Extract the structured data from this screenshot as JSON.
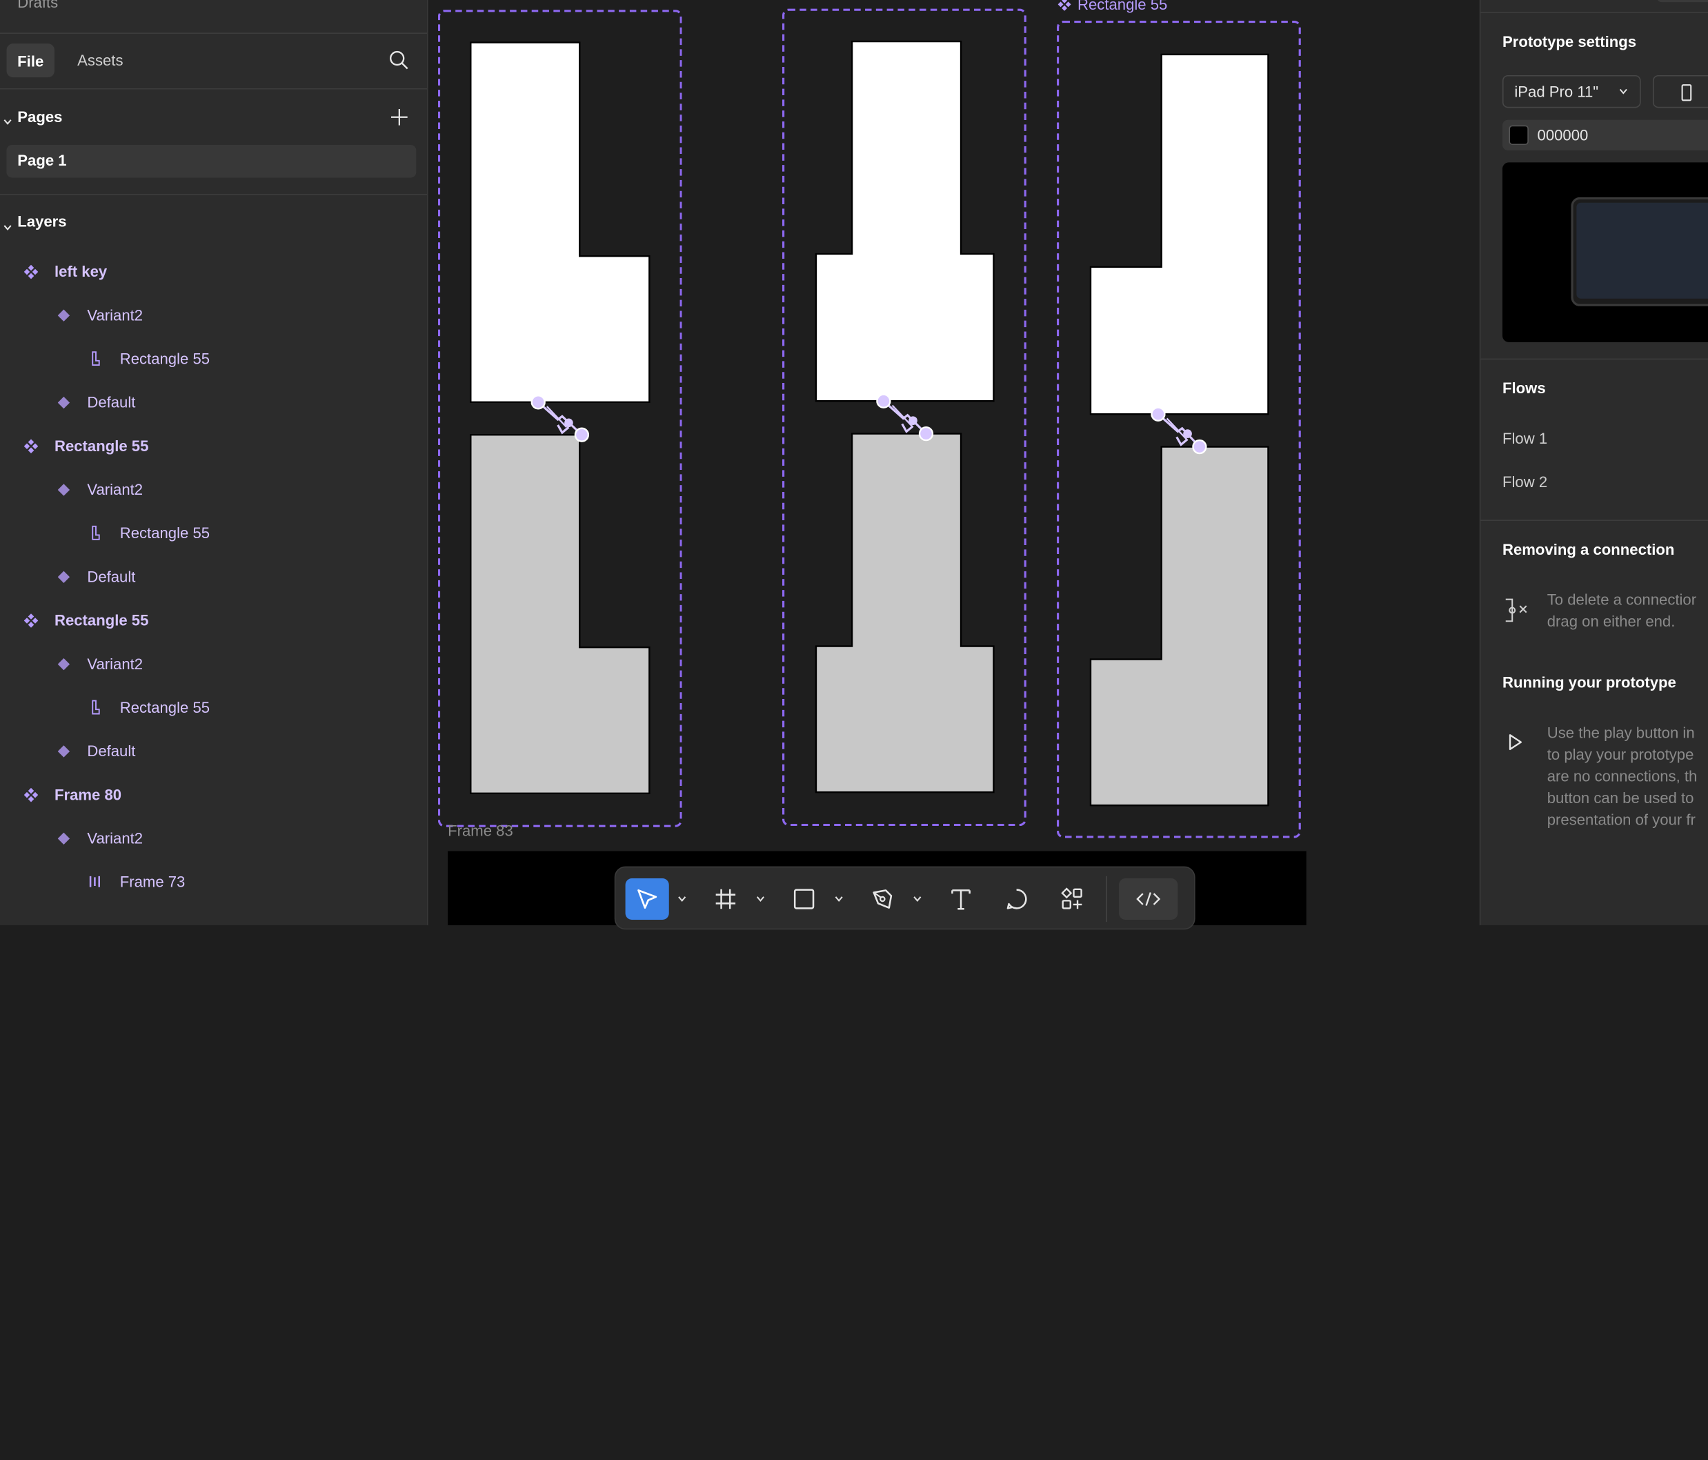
{
  "left_panel": {
    "drafts_label": "Drafts",
    "tabs": {
      "file": "File",
      "assets": "Assets"
    },
    "pages_title": "Pages",
    "pages": [
      "Page 1"
    ],
    "layers_title": "Layers",
    "layers": [
      {
        "label": "left key",
        "type": "component-set",
        "depth": 0
      },
      {
        "label": "Variant2",
        "type": "component",
        "depth": 1
      },
      {
        "label": "Rectangle 55",
        "type": "vector",
        "depth": 2
      },
      {
        "label": "Default",
        "type": "component",
        "depth": 1
      },
      {
        "label": "Rectangle 55",
        "type": "component-set",
        "depth": 0
      },
      {
        "label": "Variant2",
        "type": "component",
        "depth": 1
      },
      {
        "label": "Rectangle 55",
        "type": "vector",
        "depth": 2
      },
      {
        "label": "Default",
        "type": "component",
        "depth": 1
      },
      {
        "label": "Rectangle 55",
        "type": "component-set",
        "depth": 0
      },
      {
        "label": "Variant2",
        "type": "component",
        "depth": 1
      },
      {
        "label": "Rectangle 55",
        "type": "vector",
        "depth": 2
      },
      {
        "label": "Default",
        "type": "component",
        "depth": 1
      },
      {
        "label": "Frame 80",
        "type": "component-set",
        "depth": 0
      },
      {
        "label": "Variant2",
        "type": "component",
        "depth": 1
      },
      {
        "label": "Frame 73",
        "type": "frame",
        "depth": 2
      }
    ]
  },
  "canvas": {
    "component_label": "Rectangle 55",
    "frame_label": "Frame 83"
  },
  "toolbar": {
    "tools": [
      "move-tool",
      "frame-tool",
      "shape-tool",
      "pen-tool",
      "text-tool",
      "comment-tool",
      "actions-tool",
      "dev-mode-toggle"
    ]
  },
  "right_panel": {
    "prototype_settings_title": "Prototype settings",
    "device": "iPad Pro 11\"",
    "background_hex": "000000",
    "flows_title": "Flows",
    "flows": [
      "Flow 1",
      "Flow 2"
    ],
    "removing_title": "Removing a connection",
    "removing_text_1": "To delete a connectior",
    "removing_text_2": "drag on either end.",
    "running_title": "Running your prototype",
    "running_lines": [
      "Use the play button in",
      "to play your prototype",
      "are no connections, th",
      "button can be used to",
      "presentation of your fr"
    ]
  },
  "colors": {
    "accent": "#8d68f0",
    "layer_text": "#d6c4ff",
    "active_tool": "#3b82e6",
    "key_top": "#ffffff",
    "key_bottom": "#c8c8c8"
  }
}
